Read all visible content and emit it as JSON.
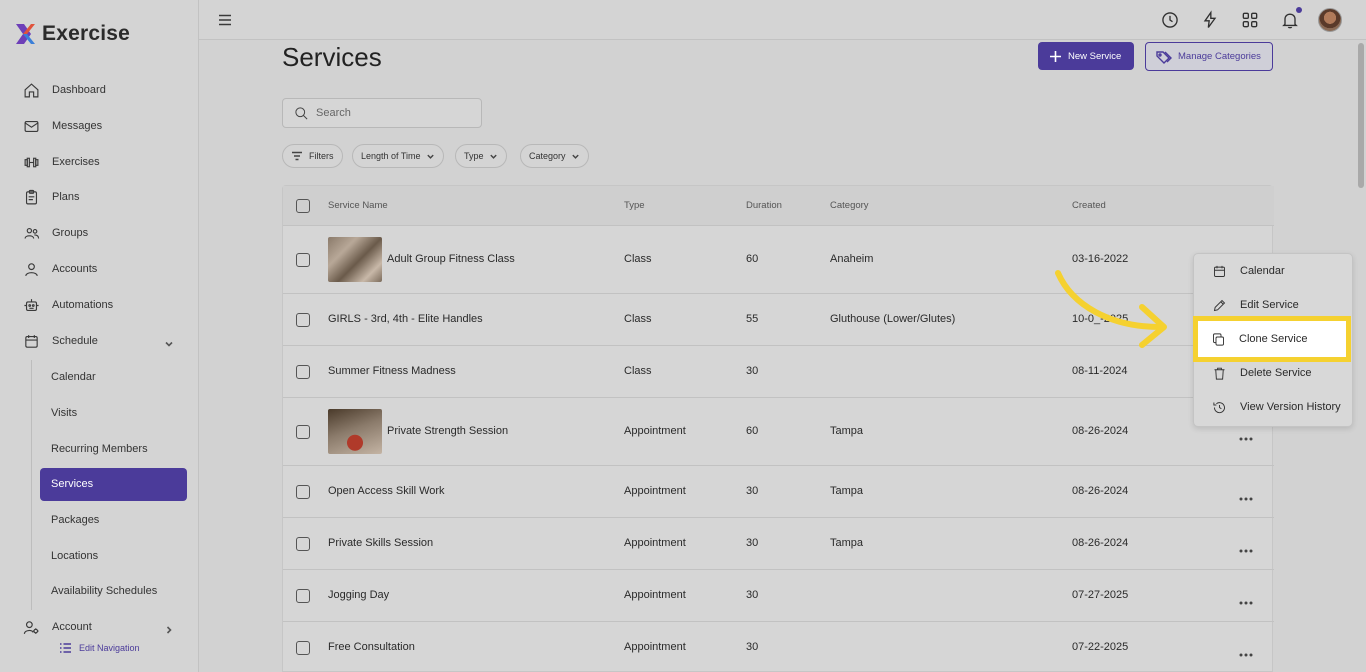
{
  "app": {
    "name": "Exercise"
  },
  "sidebar": {
    "items": [
      {
        "label": "Dashboard",
        "icon": "home-icon"
      },
      {
        "label": "Messages",
        "icon": "mail-icon"
      },
      {
        "label": "Exercises",
        "icon": "dumbbell-icon"
      },
      {
        "label": "Plans",
        "icon": "clipboard-icon"
      },
      {
        "label": "Groups",
        "icon": "users-icon"
      },
      {
        "label": "Accounts",
        "icon": "user-icon"
      },
      {
        "label": "Automations",
        "icon": "robot-icon"
      },
      {
        "label": "Schedule",
        "icon": "calendar-icon"
      }
    ],
    "schedule_sub": [
      "Calendar",
      "Visits",
      "Recurring Members",
      "Services",
      "Packages",
      "Locations",
      "Availability Schedules"
    ],
    "account_label": "Account",
    "edit_nav_label": "Edit Navigation"
  },
  "page": {
    "title": "Services",
    "new_button": "New Service",
    "manage_button": "Manage Categories",
    "search_placeholder": "Search"
  },
  "filters": [
    "Filters",
    "Length of Time",
    "Type",
    "Category"
  ],
  "table": {
    "headers": [
      "Service Name",
      "Type",
      "Duration",
      "Category",
      "Created"
    ],
    "rows": [
      {
        "name": "Adult Group Fitness Class",
        "type": "Class",
        "duration": "60",
        "category": "Anaheim",
        "created": "03-16-2022"
      },
      {
        "name": "GIRLS - 3rd, 4th - Elite Handles",
        "type": "Class",
        "duration": "55",
        "category": "Gluthouse (Lower/Glutes)",
        "created": "10-0_-2025"
      },
      {
        "name": "Summer Fitness Madness",
        "type": "Class",
        "duration": "30",
        "category": "",
        "created": "08-11-2024"
      },
      {
        "name": "Private Strength Session",
        "type": "Appointment",
        "duration": "60",
        "category": "Tampa",
        "created": "08-26-2024"
      },
      {
        "name": "Open Access Skill Work",
        "type": "Appointment",
        "duration": "30",
        "category": "Tampa",
        "created": "08-26-2024"
      },
      {
        "name": "Private Skills Session",
        "type": "Appointment",
        "duration": "30",
        "category": "Tampa",
        "created": "08-26-2024"
      },
      {
        "name": "Jogging Day",
        "type": "Appointment",
        "duration": "30",
        "category": "",
        "created": "07-27-2025"
      },
      {
        "name": "Free Consultation",
        "type": "Appointment",
        "duration": "30",
        "category": "",
        "created": "07-22-2025"
      }
    ]
  },
  "context_menu": {
    "items": [
      {
        "label": "Calendar",
        "icon": "calendar-icon"
      },
      {
        "label": "Edit Service",
        "icon": "pencil-icon"
      },
      {
        "label": "Clone Service",
        "icon": "copy-icon"
      },
      {
        "label": "Delete Service",
        "icon": "trash-icon"
      },
      {
        "label": "View Version History",
        "icon": "history-icon"
      }
    ],
    "highlight_color": "#f5d130"
  },
  "colors": {
    "accent": "#4b3b9a",
    "highlight": "#f5d130"
  }
}
